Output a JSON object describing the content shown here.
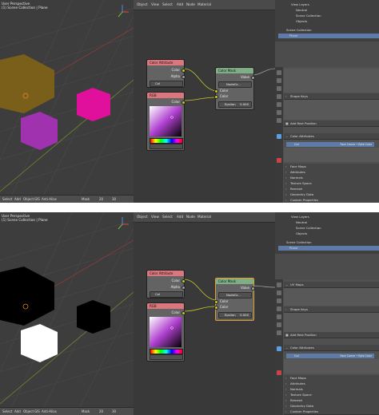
{
  "viewport": {
    "title_line1": "User Perspective",
    "title_line2": "(1) Scene Collection | Plane",
    "footer": [
      "Select",
      "Add",
      "Object",
      "GIS",
      "Anti-Alias",
      "Mask",
      "20",
      "30"
    ]
  },
  "node_editor": {
    "header": [
      "Object",
      "View",
      "Select",
      "Add",
      "Node",
      "Material"
    ],
    "color_attribute": {
      "title": "Color Attribute",
      "out_color": "Color",
      "out_alpha": "Alpha",
      "layer": "Col"
    },
    "rgb": {
      "title": "RGB",
      "out_color": "Color"
    },
    "color_mask": {
      "title": "Color Mask",
      "out_value": "Value",
      "node_group": "NodeGr...",
      "in_color1": "Color",
      "in_color2": "Color",
      "epsilon_label": "Epsilon",
      "epsilon_value": "0.000"
    }
  },
  "outliner": {
    "items": [
      "View Layers",
      "Neutral",
      "Scene Collection",
      "Objects"
    ],
    "scene_collection": "Scene Collection",
    "plane": "Plane"
  },
  "properties": {
    "panels": [
      "Shape Keys",
      "Add Rest Position",
      "Color Attributes",
      "Face Maps",
      "Attributes",
      "Normals",
      "Texture Space",
      "Remesh",
      "Geometry Data"
    ],
    "color_attr_row": "Col",
    "color_attr_domain": "Face Corner • Byte Color",
    "uv_maps": "UV Maps",
    "custom": "Custom Properties"
  },
  "colors": {
    "top_cube_large": "#7a5f1a",
    "top_cube_pink": "#e0109c",
    "top_cube_purple": "#a032b0",
    "bottom_cube_large": "#000000",
    "bottom_cube_right": "#000000",
    "bottom_cube_white": "#ffffff",
    "accent_selected": "#5d7ba6"
  }
}
